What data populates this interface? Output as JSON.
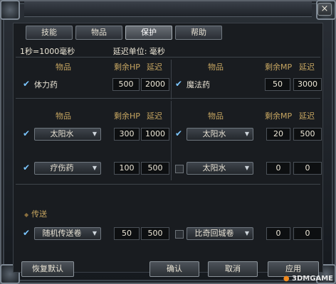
{
  "window": {
    "close_label": "×"
  },
  "tabs": [
    {
      "label": "技能"
    },
    {
      "label": "物品"
    },
    {
      "label": "保护",
      "active": true
    },
    {
      "label": "帮助"
    }
  ],
  "info": {
    "left": "1秒=1000毫秒",
    "right": "延迟单位: 毫秒"
  },
  "columns": {
    "left1": {
      "item": "物品",
      "value": "剩余HP",
      "delay": "延迟"
    },
    "right1": {
      "item": "物品",
      "value": "剩余MP",
      "delay": "延迟"
    },
    "left2": {
      "item": "物品",
      "value": "剩余HP",
      "delay": "延迟"
    },
    "right2": {
      "item": "物品",
      "value": "剩余MP",
      "delay": "延迟"
    }
  },
  "rows": {
    "left1": {
      "label": "体力药",
      "value": "500",
      "delay": "2000",
      "checked": true
    },
    "right1": {
      "label": "魔法药",
      "value": "50",
      "delay": "3000",
      "checked": true
    },
    "left2": {
      "item": "太阳水",
      "value": "300",
      "delay": "1000",
      "checked": true
    },
    "right2": {
      "item": "太阳水",
      "value": "20",
      "delay": "500",
      "checked": true
    },
    "left3": {
      "item": "疗伤药",
      "value": "100",
      "delay": "500",
      "checked": true
    },
    "right3": {
      "item": "太阳水",
      "value": "0",
      "delay": "0",
      "checked": false
    }
  },
  "teleport": {
    "title": "传送",
    "left": {
      "item": "随机传送卷",
      "value": "50",
      "delay": "500",
      "checked": true
    },
    "right": {
      "item": "比奇回城卷",
      "value": "0",
      "delay": "0",
      "checked": false
    }
  },
  "buttons": {
    "reset": "恢复默认",
    "ok": "确认",
    "cancel": "取消",
    "apply": "应用"
  },
  "watermark": {
    "text": "3DMGAME"
  }
}
